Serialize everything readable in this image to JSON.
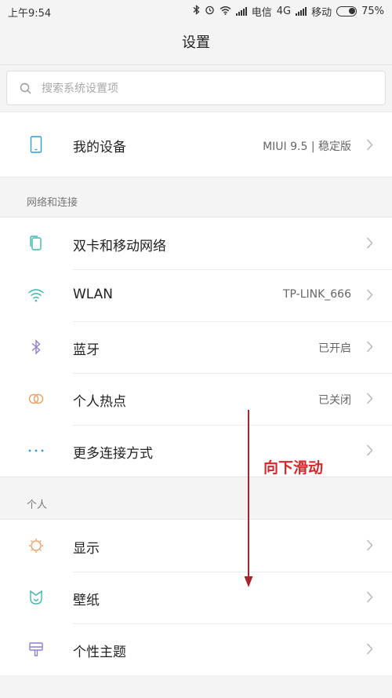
{
  "status_bar": {
    "time": "上午9:54",
    "carrier1": "电信",
    "network": "4G",
    "carrier2": "移动",
    "battery": "75%"
  },
  "title": "设置",
  "search": {
    "placeholder": "搜索系统设置项"
  },
  "device": {
    "label": "我的设备",
    "value": "MIUI 9.5 | 稳定版"
  },
  "network_section": {
    "header": "网络和连接",
    "items": [
      {
        "label": "双卡和移动网络",
        "value": ""
      },
      {
        "label": "WLAN",
        "value": "TP-LINK_666"
      },
      {
        "label": "蓝牙",
        "value": "已开启"
      },
      {
        "label": "个人热点",
        "value": "已关闭"
      },
      {
        "label": "更多连接方式",
        "value": ""
      }
    ]
  },
  "personal_section": {
    "header": "个人",
    "items": [
      {
        "label": "显示"
      },
      {
        "label": "壁纸"
      },
      {
        "label": "个性主题"
      }
    ]
  },
  "annotation": "向下滑动",
  "colors": {
    "accent_blue": "#2a9fd6",
    "wifi_teal": "#3ab8b0",
    "bluetooth_purple": "#8e7fd4",
    "hotspot_orange": "#f0a063",
    "annotation_red": "#d9262b"
  }
}
